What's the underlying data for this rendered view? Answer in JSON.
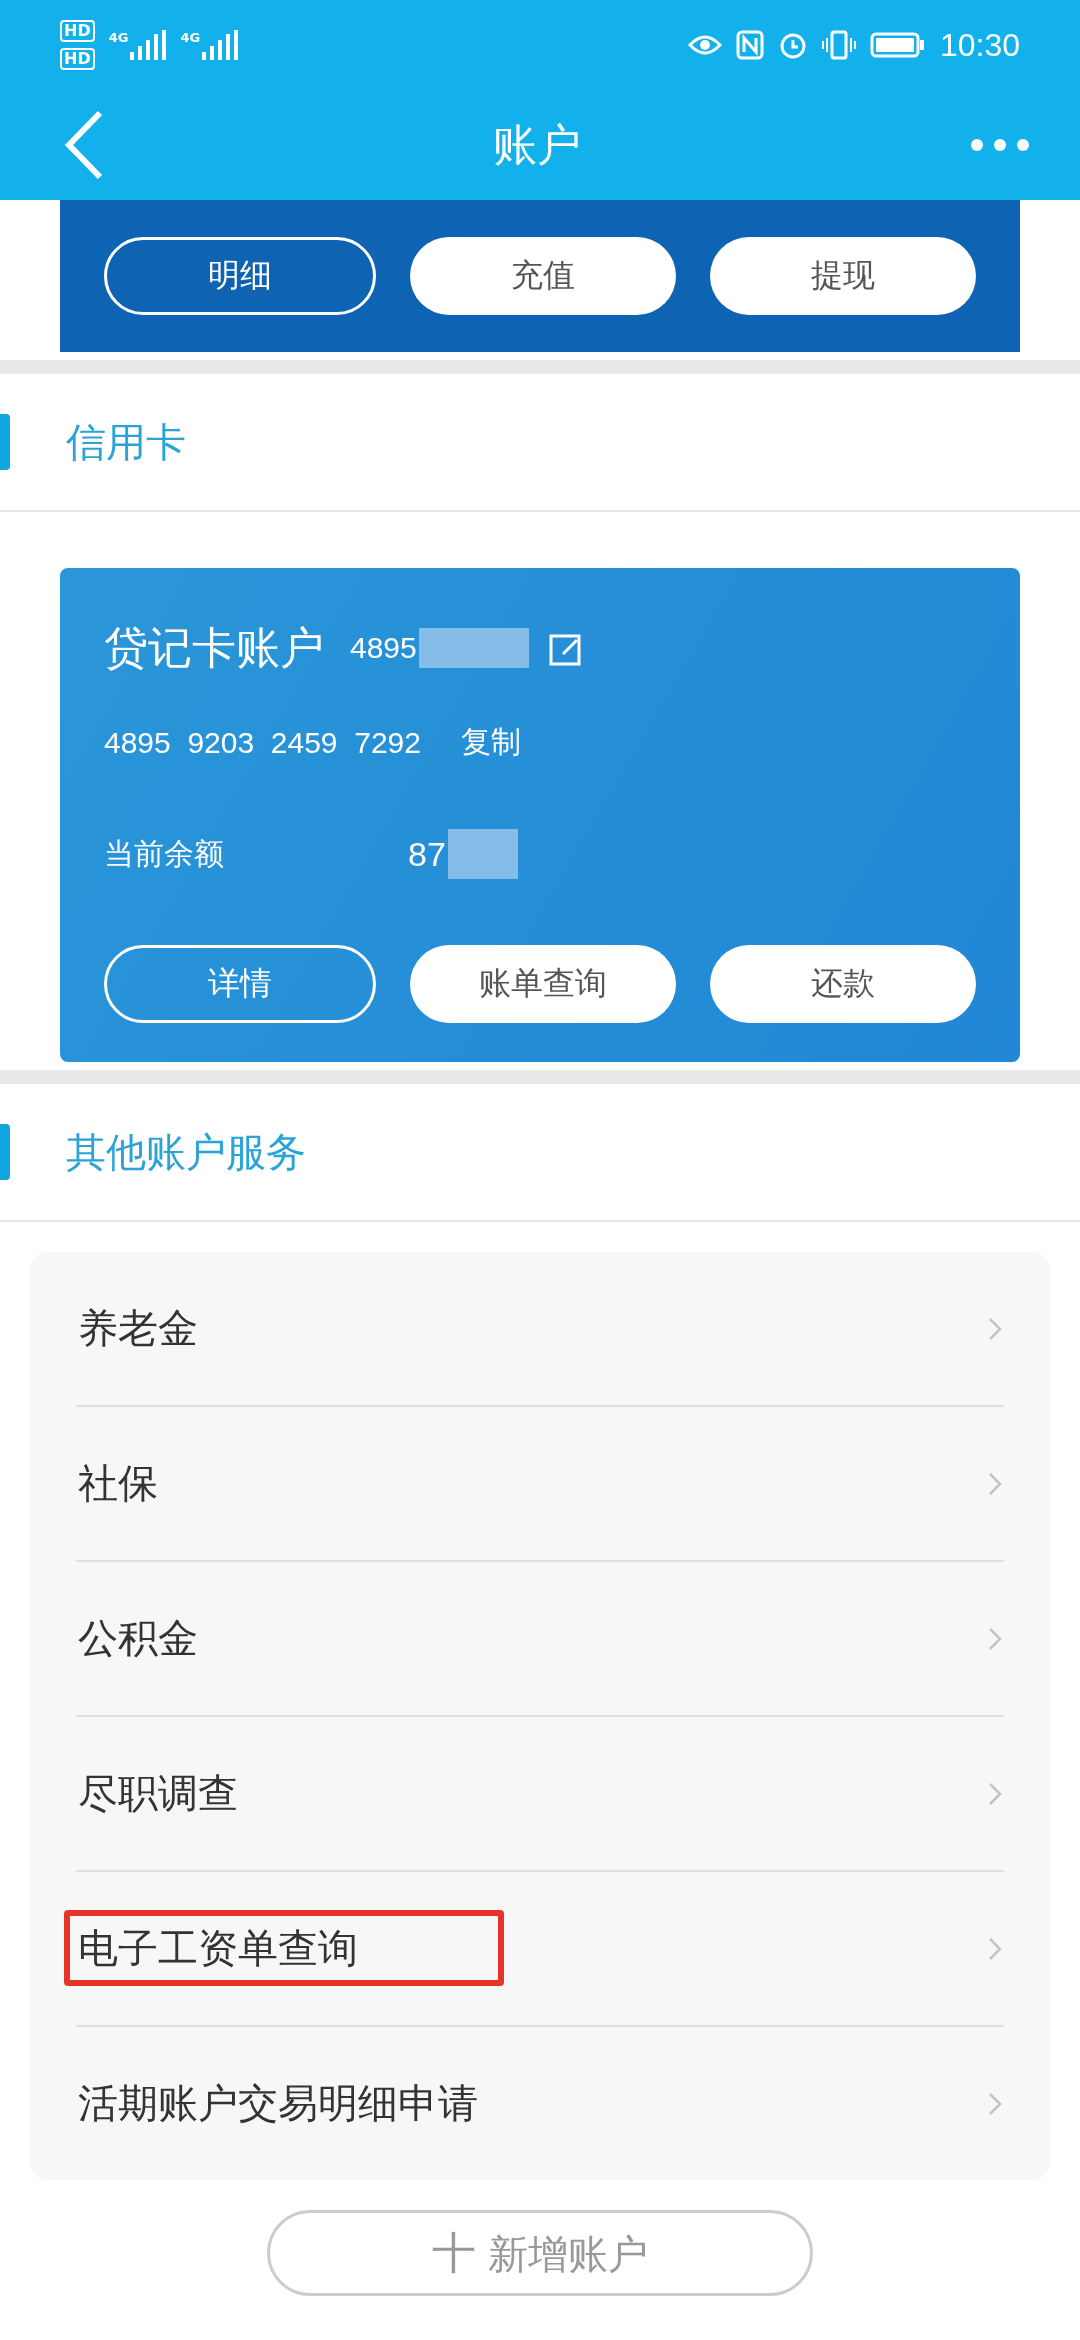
{
  "status_bar": {
    "time": "10:30",
    "sim_labels": [
      "HD",
      "HD"
    ],
    "network": [
      "4G",
      "4G"
    ]
  },
  "nav": {
    "title": "账户"
  },
  "top_card": {
    "buttons": [
      {
        "label": "明细",
        "kind": "outline"
      },
      {
        "label": "充值",
        "kind": "filled"
      },
      {
        "label": "提现",
        "kind": "filled"
      }
    ]
  },
  "credit_section": {
    "title": "信用卡"
  },
  "credit_card": {
    "title": "贷记卡账户",
    "number_masked": "4895",
    "number": "4895  9203  2459  7292",
    "copy": "复制",
    "balance_label": "当前余额",
    "balance": "87",
    "buttons": [
      {
        "label": "详情",
        "kind": "outline"
      },
      {
        "label": "账单查询",
        "kind": "filled"
      },
      {
        "label": "还款",
        "kind": "filled"
      }
    ]
  },
  "other_section": {
    "title": "其他账户服务"
  },
  "services": [
    {
      "label": "养老金",
      "highlighted": false
    },
    {
      "label": "社保",
      "highlighted": false
    },
    {
      "label": "公积金",
      "highlighted": false
    },
    {
      "label": "尽职调查",
      "highlighted": false
    },
    {
      "label": "电子工资单查询",
      "highlighted": true
    },
    {
      "label": "活期账户交易明细申请",
      "highlighted": false
    }
  ],
  "add_button": {
    "icon": "十",
    "label": "新增账户"
  }
}
